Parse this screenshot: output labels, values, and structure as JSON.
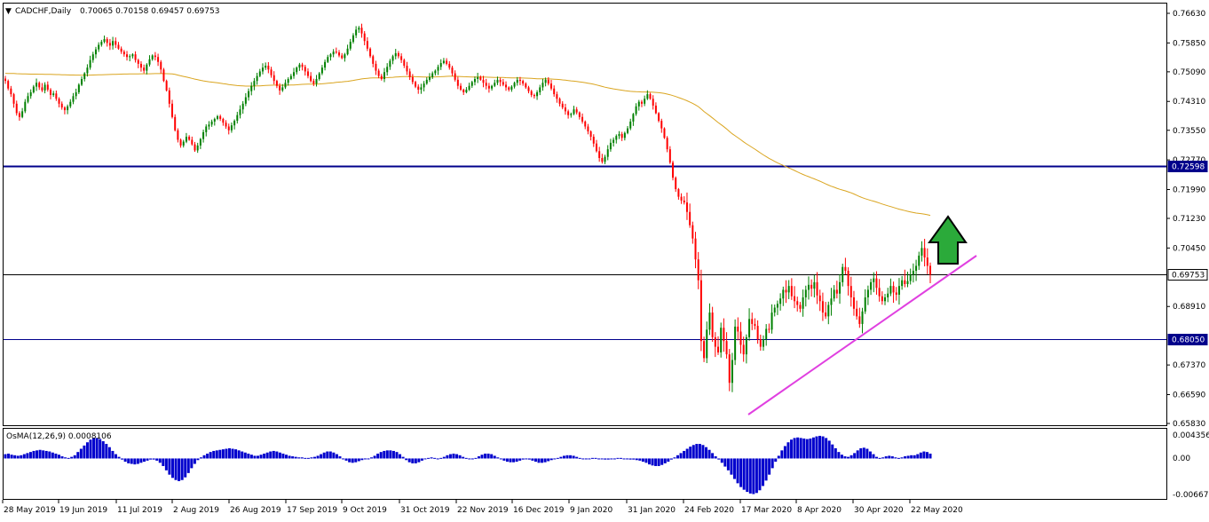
{
  "header": {
    "title": "CADCHF,Daily",
    "ohlc": "0.70065 0.70158 0.69457 0.69753",
    "collapse_marker": "▼"
  },
  "indicator": {
    "title": "OsMA(12,26,9) 0.0008106",
    "axis_labels": [
      "0.0043562",
      "0.00",
      "-0.006679"
    ],
    "bar_color": "#0000CD"
  },
  "colors": {
    "background_plot": "#FFFFFF",
    "up_candle": "#008000",
    "down_candle": "#FF0000",
    "ma_line": "#DAA520",
    "level_lines": "#00008B",
    "price_line": "#000000",
    "trendline": "#E040E0",
    "arrow_fill": "#2BAA3A"
  },
  "chart_data": {
    "type": "candlestick",
    "title": "CADCHF,Daily",
    "symbol": "CADCHF",
    "timeframe": "Daily",
    "last_ohlc": {
      "open": 0.70065,
      "high": 0.70158,
      "low": 0.69457,
      "close": 0.69753
    },
    "y_ticks": [
      "0.76630",
      "0.75850",
      "0.75090",
      "0.74310",
      "0.73550",
      "0.72770",
      "0.71990",
      "0.71230",
      "0.70450",
      "0.68910",
      "0.67370",
      "0.66590",
      "0.65830"
    ],
    "x_ticks": [
      "28 May 2019",
      "19 Jun 2019",
      "11 Jul 2019",
      "2 Aug 2019",
      "26 Aug 2019",
      "17 Sep 2019",
      "9 Oct 2019",
      "31 Oct 2019",
      "22 Nov 2019",
      "16 Dec 2019",
      "9 Jan 2020",
      "31 Jan 2020",
      "24 Feb 2020",
      "17 Mar 2020",
      "8 Apr 2020",
      "30 Apr 2020",
      "22 May 2020"
    ],
    "ylim": [
      0.6578,
      0.7685
    ],
    "levels": [
      {
        "price": 0.72598,
        "label": "0.72598"
      },
      {
        "price": 0.69753,
        "label": "0.69753"
      },
      {
        "price": 0.6805,
        "label": "0.68050"
      }
    ],
    "closes": [
      0.7485,
      0.7465,
      0.745,
      0.7425,
      0.74,
      0.739,
      0.7405,
      0.743,
      0.7445,
      0.7455,
      0.747,
      0.748,
      0.7468,
      0.746,
      0.7475,
      0.7462,
      0.7448,
      0.7452,
      0.7438,
      0.7425,
      0.7415,
      0.7408,
      0.7418,
      0.743,
      0.7445,
      0.7455,
      0.7475,
      0.749,
      0.7505,
      0.752,
      0.754,
      0.7555,
      0.7568,
      0.758,
      0.7588,
      0.7595,
      0.7585,
      0.7578,
      0.759,
      0.758,
      0.757,
      0.7562,
      0.7555,
      0.7548,
      0.755,
      0.7555,
      0.754,
      0.753,
      0.752,
      0.7512,
      0.7528,
      0.7542,
      0.7552,
      0.7548,
      0.7535,
      0.7515,
      0.7485,
      0.746,
      0.7425,
      0.739,
      0.7355,
      0.733,
      0.7315,
      0.7325,
      0.7338,
      0.733,
      0.7318,
      0.7302,
      0.7315,
      0.7332,
      0.735,
      0.7365,
      0.737,
      0.7378,
      0.7385,
      0.7392,
      0.7385,
      0.7375,
      0.7365,
      0.7355,
      0.7368,
      0.738,
      0.7395,
      0.741,
      0.7425,
      0.7442,
      0.7458,
      0.7472,
      0.7485,
      0.7498,
      0.751,
      0.752,
      0.7525,
      0.7515,
      0.75,
      0.7485,
      0.7472,
      0.746,
      0.7468,
      0.748,
      0.749,
      0.7498,
      0.7508,
      0.752,
      0.7528,
      0.7522,
      0.751,
      0.7498,
      0.7485,
      0.7478,
      0.749,
      0.7505,
      0.752,
      0.7535,
      0.7548,
      0.7555,
      0.7562,
      0.756,
      0.7552,
      0.7545,
      0.7555,
      0.757,
      0.7588,
      0.7605,
      0.762,
      0.7625,
      0.761,
      0.759,
      0.757,
      0.755,
      0.753,
      0.7512,
      0.7498,
      0.749,
      0.7508,
      0.7522,
      0.7538,
      0.755,
      0.7558,
      0.755,
      0.754,
      0.7525,
      0.751,
      0.7495,
      0.7482,
      0.747,
      0.7462,
      0.7468,
      0.7478,
      0.7488,
      0.7495,
      0.7505,
      0.7512,
      0.7522,
      0.7532,
      0.7538,
      0.753,
      0.752,
      0.7505,
      0.7488,
      0.7472,
      0.7462,
      0.7455,
      0.7462,
      0.7472,
      0.7482,
      0.749,
      0.7495,
      0.7488,
      0.748,
      0.7472,
      0.7465,
      0.7472,
      0.748,
      0.7488,
      0.7482,
      0.7475,
      0.7468,
      0.7462,
      0.747,
      0.748,
      0.7488,
      0.7485,
      0.7478,
      0.7468,
      0.7458,
      0.7448,
      0.7445,
      0.7455,
      0.7468,
      0.748,
      0.7488,
      0.7478,
      0.7465,
      0.745,
      0.7438,
      0.7425,
      0.7415,
      0.7405,
      0.7395,
      0.7398,
      0.741,
      0.7402,
      0.739,
      0.7378,
      0.7365,
      0.7352,
      0.7338,
      0.732,
      0.73,
      0.7282,
      0.7272,
      0.7285,
      0.7305,
      0.7322,
      0.733,
      0.734,
      0.7345,
      0.7335,
      0.7348,
      0.736,
      0.7378,
      0.7398,
      0.7418,
      0.743,
      0.7425,
      0.7438,
      0.745,
      0.7438,
      0.742,
      0.74,
      0.738,
      0.736,
      0.7335,
      0.7305,
      0.727,
      0.723,
      0.72,
      0.718,
      0.717,
      0.7165,
      0.714,
      0.7105,
      0.707,
      0.7015,
      0.696,
      0.68,
      0.6755,
      0.683,
      0.6875,
      0.681,
      0.6785,
      0.677,
      0.6835,
      0.68,
      0.6765,
      0.669,
      0.675,
      0.6838,
      0.6825,
      0.679,
      0.6765,
      0.681,
      0.6858,
      0.6845,
      0.684,
      0.6805,
      0.6785,
      0.6805,
      0.6832,
      0.683,
      0.6875,
      0.6888,
      0.6898,
      0.6912,
      0.6935,
      0.6928,
      0.6945,
      0.6918,
      0.6905,
      0.6895,
      0.6885,
      0.6915,
      0.6935,
      0.6948,
      0.6938,
      0.6955,
      0.692,
      0.6905,
      0.6875,
      0.6865,
      0.6895,
      0.6912,
      0.6935,
      0.6925,
      0.6955,
      0.6995,
      0.6985,
      0.6945,
      0.6915,
      0.6885,
      0.6865,
      0.6845,
      0.6878,
      0.6915,
      0.6935,
      0.6955,
      0.6965,
      0.694,
      0.6918,
      0.6905,
      0.6915,
      0.6925,
      0.6945,
      0.6928,
      0.6922,
      0.6945,
      0.696,
      0.695,
      0.6958,
      0.6975,
      0.6985,
      0.6998,
      0.7025,
      0.7045,
      0.702,
      0.6998,
      0.6975
    ],
    "ma_start": 0.7505,
    "ma_note": "200-period moving average",
    "osma_values": [
      0.0008,
      0.0009,
      0.0007,
      0.0006,
      0.0005,
      0.0006,
      0.0008,
      0.001,
      0.0012,
      0.0014,
      0.0015,
      0.0016,
      0.0015,
      0.0014,
      0.0013,
      0.0011,
      0.0009,
      0.0007,
      0.0004,
      0.0002,
      0.0001,
      0.0003,
      0.0006,
      0.0012,
      0.0018,
      0.0024,
      0.003,
      0.0035,
      0.0038,
      0.0038,
      0.0036,
      0.0032,
      0.0027,
      0.0021,
      0.0014,
      0.0008,
      0.0003,
      -0.0002,
      -0.0006,
      -0.0009,
      -0.001,
      -0.0011,
      -0.001,
      -0.0008,
      -0.0006,
      -0.0004,
      -0.0002,
      -0.0002,
      -0.0004,
      -0.0008,
      -0.0014,
      -0.0022,
      -0.003,
      -0.0036,
      -0.004,
      -0.0042,
      -0.004,
      -0.0035,
      -0.0027,
      -0.0018,
      -0.001,
      -0.0003,
      0.0002,
      0.0006,
      0.0009,
      0.0012,
      0.0014,
      0.0015,
      0.0016,
      0.0017,
      0.0018,
      0.0019,
      0.0018,
      0.0017,
      0.0015,
      0.0013,
      0.0011,
      0.0009,
      0.0007,
      0.0005,
      0.0005,
      0.0007,
      0.0009,
      0.0011,
      0.0013,
      0.0014,
      0.0013,
      0.0011,
      0.0009,
      0.0007,
      0.0005,
      0.0004,
      0.0003,
      0.0002,
      0.0002,
      0.0001,
      0.0001,
      0.0002,
      0.0003,
      0.0005,
      0.0008,
      0.0011,
      0.0013,
      0.0013,
      0.0011,
      0.0008,
      0.0004,
      0.0,
      -0.0004,
      -0.0007,
      -0.0008,
      -0.0007,
      -0.0005,
      -0.0003,
      -0.0001,
      0.0,
      0.0002,
      0.0005,
      0.0009,
      0.0012,
      0.0014,
      0.0015,
      0.0015,
      0.0014,
      0.0012,
      0.0008,
      0.0003,
      -0.0003,
      -0.0007,
      -0.0009,
      -0.0009,
      -0.0007,
      -0.0004,
      -0.0001,
      0.0001,
      0.0002,
      0.0001,
      0.0,
      0.0001,
      0.0003,
      0.0006,
      0.0008,
      0.0009,
      0.0008,
      0.0006,
      0.0003,
      0.0001,
      -0.0001,
      -0.0001,
      0.0001,
      0.0004,
      0.0007,
      0.0009,
      0.0009,
      0.0008,
      0.0005,
      0.0002,
      -0.0001,
      -0.0004,
      -0.0006,
      -0.0007,
      -0.0007,
      -0.0006,
      -0.0004,
      -0.0002,
      -0.0001,
      -0.0002,
      -0.0004,
      -0.0006,
      -0.0008,
      -0.0008,
      -0.0007,
      -0.0005,
      -0.0003,
      -0.0001,
      0.0001,
      0.0003,
      0.0005,
      0.0006,
      0.0006,
      0.0005,
      0.0003,
      0.0001,
      -0.0001,
      -0.0001,
      0.0,
      0.0001,
      0.0001,
      0.0,
      -0.0001,
      -0.0002,
      -0.0002,
      -0.0001,
      0.0,
      0.0001,
      0.0001,
      0.0,
      -0.0001,
      -0.0002,
      -0.0002,
      -0.0003,
      -0.0004,
      -0.0006,
      -0.0008,
      -0.0011,
      -0.0013,
      -0.0014,
      -0.0014,
      -0.0012,
      -0.0009,
      -0.0006,
      -0.0002,
      0.0002,
      0.0006,
      0.001,
      0.0014,
      0.0018,
      0.0022,
      0.0025,
      0.0027,
      0.0027,
      0.0025,
      0.0021,
      0.0016,
      0.001,
      0.0004,
      -0.0002,
      -0.0008,
      -0.0015,
      -0.0022,
      -0.003,
      -0.0038,
      -0.0046,
      -0.0053,
      -0.0058,
      -0.0062,
      -0.0065,
      -0.0066,
      -0.0064,
      -0.0059,
      -0.0051,
      -0.0041,
      -0.003,
      -0.0018,
      -0.0006,
      0.0005,
      0.0015,
      0.0023,
      0.003,
      0.0035,
      0.0038,
      0.0039,
      0.0038,
      0.0037,
      0.0036,
      0.0037,
      0.0039,
      0.0041,
      0.0042,
      0.0041,
      0.0038,
      0.0033,
      0.0026,
      0.0019,
      0.0012,
      0.0007,
      0.0004,
      0.0003,
      0.0006,
      0.001,
      0.0015,
      0.0019,
      0.002,
      0.0018,
      0.0013,
      0.0008,
      0.0003,
      0.0001,
      0.0002,
      0.0004,
      0.0005,
      0.0004,
      0.0002,
      0.0001,
      0.0002,
      0.0004,
      0.0005,
      0.0006,
      0.0006,
      0.0008,
      0.0011,
      0.0013,
      0.0012,
      0.0009
    ]
  }
}
